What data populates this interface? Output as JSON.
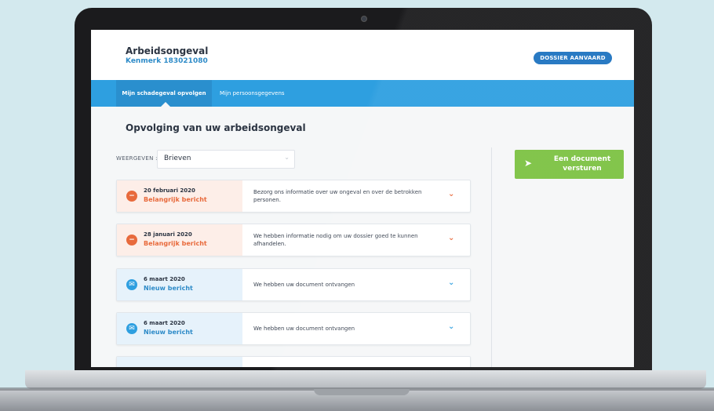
{
  "header": {
    "case_title": "Arbeidsongeval",
    "case_reference": "Kenmerk 183021080",
    "status_button": "DOSSIER AANVAARD"
  },
  "tabs": [
    {
      "label": "Mijn schadegeval opvolgen",
      "active": true
    },
    {
      "label": "Mijn persoonsgegevens",
      "active": false
    }
  ],
  "main": {
    "title": "Opvolging van uw arbeidsongeval",
    "filter": {
      "label": "WEERGEVEN :",
      "value": "Brieven"
    },
    "send_button": "Een document versturen"
  },
  "messages": [
    {
      "date": "20 februari 2020",
      "status": "Belangrijk bericht",
      "type": "important",
      "icon": "minus-circle-icon",
      "text": "Bezorg ons informatie over uw ongeval en over de betrokken personen."
    },
    {
      "date": "28 januari 2020",
      "status": "Belangrijk bericht",
      "type": "important",
      "icon": "minus-circle-icon",
      "text": "We hebben informatie nodig om uw dossier goed te kunnen afhandelen."
    },
    {
      "date": "6 maart 2020",
      "status": "Nieuw bericht",
      "type": "new",
      "icon": "envelope-icon",
      "text": "We hebben uw document ontvangen"
    },
    {
      "date": "6 maart 2020",
      "status": "Nieuw bericht",
      "type": "new",
      "icon": "envelope-icon",
      "text": "We hebben uw document ontvangen"
    }
  ],
  "colors": {
    "primary_blue": "#2e9fe0",
    "button_blue": "#1e73c0",
    "important_orange": "#e86a3c",
    "send_green": "#7cc242"
  }
}
